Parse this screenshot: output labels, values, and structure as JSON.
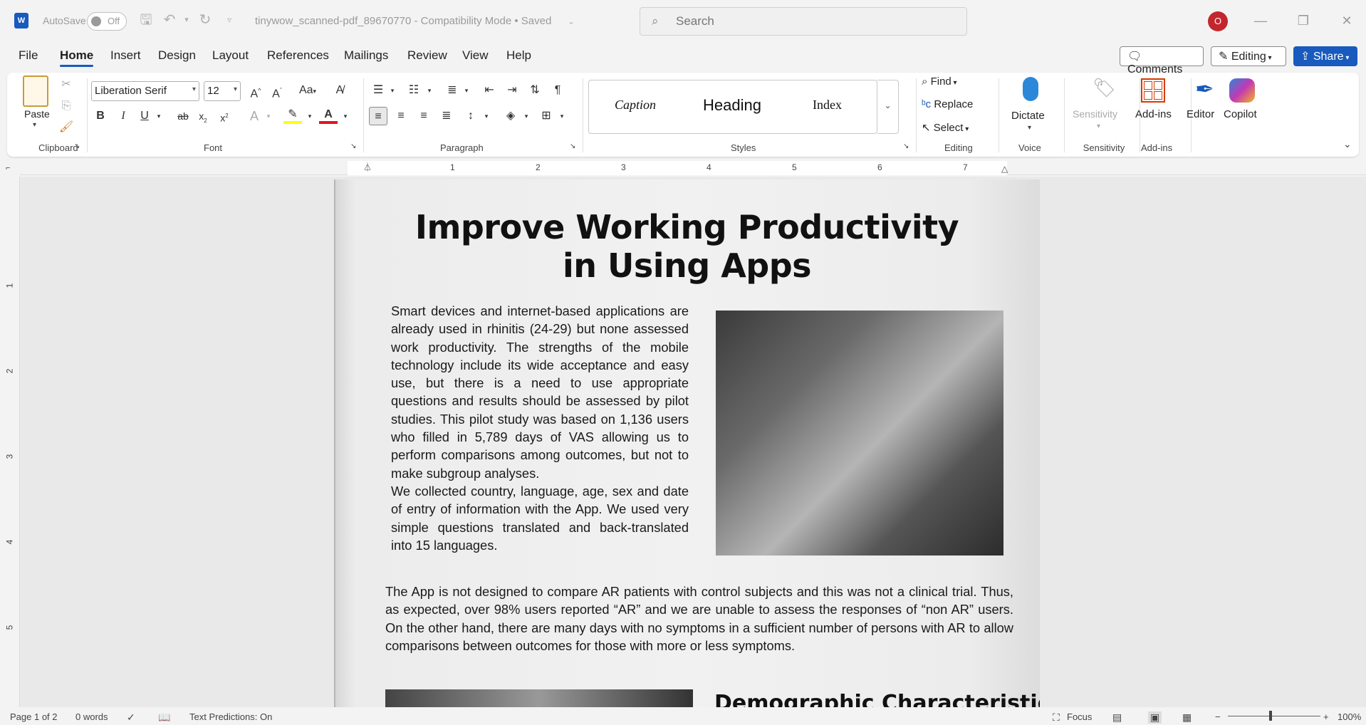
{
  "titlebar": {
    "app_icon": "W",
    "autosave_label": "AutoSave",
    "autosave_state": "Off",
    "doc_title": "tinywow_scanned-pdf_89670770  -  Compatibility Mode • Saved",
    "search_placeholder": "Search",
    "avatar_initial": "O"
  },
  "tabs": [
    "File",
    "Home",
    "Insert",
    "Design",
    "Layout",
    "References",
    "Mailings",
    "Review",
    "View",
    "Help"
  ],
  "tab_buttons": {
    "comments": "Comments",
    "editing": "Editing",
    "share": "Share"
  },
  "ribbon": {
    "clipboard": {
      "paste": "Paste",
      "label": "Clipboard"
    },
    "font": {
      "family": "Liberation Serif",
      "size": "12",
      "label": "Font",
      "aa": "Aa"
    },
    "paragraph": {
      "label": "Paragraph"
    },
    "styles": {
      "items": [
        "Caption",
        "Heading",
        "Index"
      ],
      "label": "Styles"
    },
    "editing": {
      "find": "Find",
      "replace": "Replace",
      "select": "Select",
      "label": "Editing"
    },
    "voice": {
      "dictate": "Dictate",
      "label": "Voice"
    },
    "sensitivity": {
      "button": "Sensitivity",
      "label": "Sensitivity"
    },
    "addins": {
      "button": "Add-ins",
      "label": "Add-ins"
    },
    "editor": "Editor",
    "copilot": "Copilot"
  },
  "ruler": {
    "numbers": [
      "1",
      "2",
      "3",
      "4",
      "5",
      "6",
      "7"
    ],
    "vnumbers": [
      "1",
      "2",
      "3",
      "4",
      "5"
    ]
  },
  "document": {
    "title_line1": "Improve Working Productivity",
    "title_line2": "in Using Apps",
    "para1": "Smart devices and internet-based applications are already used in rhinitis (24-29) but none assessed work productivity. The strengths of the mobile technology include its wide acceptance and easy use, but there is a need to use appropriate questions and results should be assessed by pilot studies. This pilot study was based on 1,136 users who filled in 5,789 days of VAS allowing us to perform comparisons among outcomes, but not to make subgroup analyses.",
    "para1b": "We collected country, language, age, sex and date of entry of information with the App. We used very simple questions translated and back-translated into 15 languages.",
    "para2": "The App is not designed to compare AR patients with control subjects and this was not a clinical trial. Thus, as expected, over 98% users reported “AR” and we are unable to assess the responses of “non AR” users. On the other hand, there are many days with no symptoms in a sufficient number of persons with AR to allow comparisons between outcomes for those with more or less symptoms.",
    "heading2": "Demographic Characteristics"
  },
  "status": {
    "page": "Page 1 of 2",
    "words": "0 words",
    "predictions": "Text Predictions: On",
    "focus": "Focus",
    "zoom": "100%"
  },
  "colors": {
    "accent": "#185abd",
    "avatar": "#c4262e",
    "highlight": "#ffff00",
    "font_color": "#e81123"
  }
}
